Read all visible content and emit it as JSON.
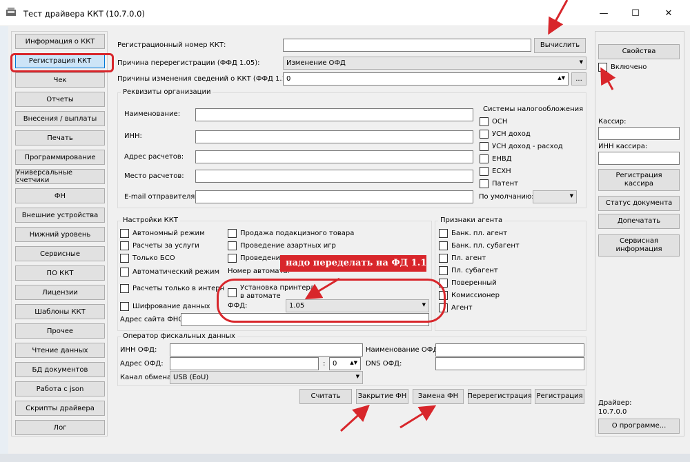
{
  "window": {
    "title": "Тест драйвера ККТ (10.7.0.0)",
    "minimize": "—",
    "maximize": "☐",
    "close": "✕"
  },
  "sidebar": {
    "items": [
      {
        "label": "Информация о ККТ"
      },
      {
        "label": "Регистрация ККТ"
      },
      {
        "label": "Чек"
      },
      {
        "label": "Отчеты"
      },
      {
        "label": "Внесения / выплаты"
      },
      {
        "label": "Печать"
      },
      {
        "label": "Программирование"
      },
      {
        "label": "Универсальные счетчики"
      },
      {
        "label": "ФН"
      },
      {
        "label": "Внешние устройства"
      },
      {
        "label": "Нижний уровень"
      },
      {
        "label": "Сервисные"
      },
      {
        "label": "ПО ККТ"
      },
      {
        "label": "Лицензии"
      },
      {
        "label": "Шаблоны ККТ"
      },
      {
        "label": "Прочее"
      },
      {
        "label": "Чтение данных"
      },
      {
        "label": "БД документов"
      },
      {
        "label": "Работа с json"
      },
      {
        "label": "Скрипты драйвера"
      },
      {
        "label": "Лог"
      }
    ],
    "selected": "Регистрация ККТ"
  },
  "form": {
    "reg_number_label": "Регистрационный номер ККТ:",
    "reg_number_value": "",
    "calc_button": "Вычислить",
    "rereg_reason_label": "Причина перерегистрации (ФФД 1.05):",
    "rereg_reason_value": "Изменение ОФД",
    "change_reasons_label": "Причины изменения сведений о ККТ (ФФД 1.1):",
    "change_reasons_value": "0",
    "more_button": "...",
    "org": {
      "title": "Реквизиты организации",
      "name_label": "Наименование:",
      "inn_label": "ИНН:",
      "address_label": "Адрес расчетов:",
      "place_label": "Место расчетов:",
      "email_label": "E-mail отправителя:"
    },
    "tax": {
      "title": "Системы налогообложения",
      "items": [
        "ОСН",
        "УСН доход",
        "УСН доход - расход",
        "ЕНВД",
        "ЕСХН",
        "Патент"
      ],
      "default_label": "По умолчанию:",
      "default_value": ""
    },
    "kkt": {
      "title": "Настройки ККТ",
      "left": [
        "Автономный режим",
        "Расчеты за услуги",
        "Только БСО",
        "Автоматический режим",
        "Расчеты только в интерн",
        "Шифрование данных"
      ],
      "right": [
        "Продажа подакцизного товара",
        "Проведение азартных игр",
        "Проведение"
      ],
      "automat_label": "Номер автомата:",
      "printer_label": "Установка принтера в автомате",
      "ffd_label": "ФФД:",
      "ffd_value": "1.05",
      "fns_site_label": "Адрес сайта ФНС:",
      "fns_site_value": ""
    },
    "agent": {
      "title": "Признаки агента",
      "items": [
        "Банк. пл. агент",
        "Банк. пл. субагент",
        "Пл. агент",
        "Пл. субагент",
        "Поверенный",
        "Комиссионер",
        "Агент"
      ]
    },
    "ofd": {
      "title": "Оператор фискальных данных",
      "inn_label": "ИНН ОФД:",
      "name_label": "Наименование ОФД:",
      "address_label": "Адрес ОФД:",
      "port_value": "0",
      "dns_label": "DNS ОФД:",
      "channel_label": "Канал обмена:",
      "channel_value": "USB (EoU)"
    },
    "buttons": {
      "read": "Считать",
      "close_fn": "Закрытие ФН",
      "replace_fn": "Замена ФН",
      "rereg": "Перерегистрация",
      "register": "Регистрация"
    }
  },
  "right_panel": {
    "properties": "Свойства",
    "enabled": "Включено",
    "cashier_label": "Кассир:",
    "cashier_inn_label": "ИНН кассира:",
    "reg_cashier": "Регистрация кассира",
    "doc_status": "Статус документа",
    "reprint": "Допечатать",
    "service_info": "Сервисная информация",
    "driver_label": "Драйвер:",
    "driver_version": "10.7.0.0",
    "about": "О программе..."
  },
  "annotation": {
    "note": "надо переделать на ФД 1.1"
  },
  "colors": {
    "annotation_red": "#d8262b",
    "selected_bg": "#cce4f7",
    "window_bg": "#f0f0f0"
  }
}
